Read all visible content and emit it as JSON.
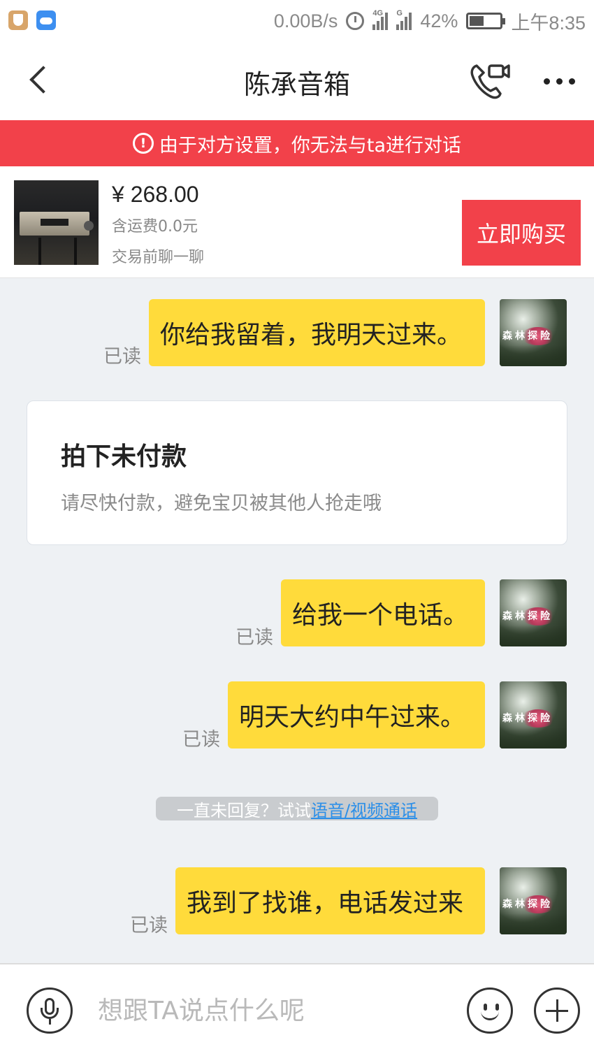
{
  "status_bar": {
    "net_speed": "0.00B/s",
    "network_type": "4G",
    "sim2": "G",
    "battery": "42%",
    "time": "上午8:35",
    "icons": [
      "shield-app-icon",
      "cloud-app-icon",
      "alarm-icon",
      "signal-icon",
      "signal-icon",
      "battery-icon"
    ]
  },
  "header": {
    "title": "陈承音箱",
    "icons": [
      "back-arrow-icon",
      "video-call-icon",
      "more-icon"
    ]
  },
  "notice": {
    "icon": "!",
    "text": "由于对方设置，你无法与ta进行对话"
  },
  "product": {
    "price": "¥ 268.00",
    "shipping": "含运费0.0元",
    "chat_tip": "交易前聊一聊",
    "buy_label": "立即购买"
  },
  "messages": [
    {
      "text": "你给我留着，我明天过来。",
      "status": "已读"
    },
    {
      "text": "给我一个电话。",
      "status": "已读"
    },
    {
      "text": "明天大约中午过来。",
      "status": "已读"
    },
    {
      "text": "我到了找谁，电话发过来",
      "status": "已读"
    }
  ],
  "order_card": {
    "title": "拍下未付款",
    "description": "请尽快付款，避免宝贝被其他人抢走哦"
  },
  "hint": {
    "text": "一直未回复？试试",
    "link": "语音/视频通话"
  },
  "avatar_label": "森林探险",
  "input_bar": {
    "placeholder": "想跟TA说点什么呢",
    "icons": [
      "microphone-icon",
      "emoji-icon",
      "plus-icon"
    ]
  },
  "colors": {
    "accent_red": "#f2414a",
    "bubble_yellow": "#ffdb3b",
    "chat_background": "#eef1f4",
    "link_blue": "#2c8fe8"
  }
}
